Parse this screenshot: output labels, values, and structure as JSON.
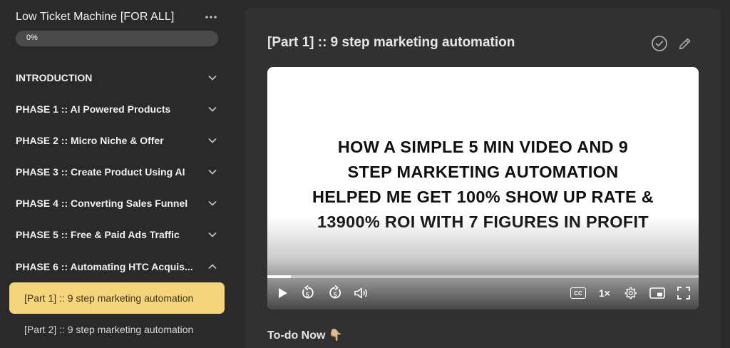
{
  "sidebar": {
    "course_title": "Low Ticket Machine [FOR ALL]",
    "progress": {
      "value": 0,
      "label": "0%"
    },
    "sections": [
      {
        "label": "INTRODUCTION",
        "expanded": false
      },
      {
        "label": "PHASE 1 :: AI Powered Products",
        "expanded": false
      },
      {
        "label": "PHASE 2 :: Micro Niche & Offer",
        "expanded": false
      },
      {
        "label": "PHASE 3 :: Create Product Using AI",
        "expanded": false
      },
      {
        "label": "PHASE 4 :: Converting Sales Funnel",
        "expanded": false
      },
      {
        "label": "PHASE 5 :: Free & Paid Ads Traffic",
        "expanded": false
      },
      {
        "label": "PHASE 6 :: Automating HTC Acquis...",
        "expanded": true
      }
    ],
    "lessons": [
      {
        "label": "[Part 1] :: 9 step marketing automation",
        "active": true
      },
      {
        "label": "[Part 2] :: 9 step marketing automation",
        "active": false
      }
    ]
  },
  "main": {
    "lesson_title": "[Part 1] :: 9 step marketing automation",
    "video": {
      "headline": [
        "HOW A SIMPLE 5 MIN VIDEO AND 9",
        "STEP MARKETING AUTOMATION",
        "HELPED ME GET 100% SHOW UP RATE &",
        "13900% ROI WITH 7 FIGURES IN PROFIT"
      ],
      "speed": "1×",
      "rewind_seconds": "5",
      "forward_seconds": "5",
      "captions_label": "CC"
    },
    "todo_label": "To-do Now 👇🏼"
  },
  "colors": {
    "accent": "#f5d57a",
    "sidebar_bg": "#2a2a2a",
    "panel_bg": "#313131"
  }
}
